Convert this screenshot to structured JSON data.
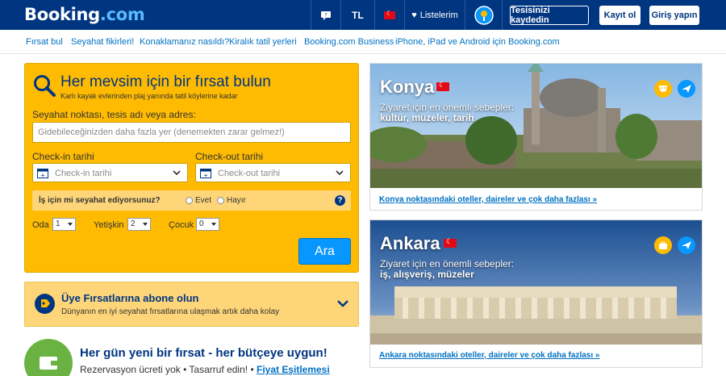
{
  "header": {
    "logo_main": "Booking",
    "logo_suffix": ".com",
    "currency": "TL",
    "wishlist_label": "Listelerim",
    "register_property": "Tesisinizi kaydedin",
    "register": "Kayıt ol",
    "sign_in": "Giriş yapın",
    "colors": {
      "brand_blue": "#003580",
      "light_blue": "#0896ff",
      "yellow": "#febb02",
      "turkey_red": "#e30a17"
    }
  },
  "subnav": {
    "items": [
      "Fırsat bul",
      "Seyahat fikirleri!",
      "Konaklamanız nasıldı?",
      "Kiralık tatil yerleri",
      "Booking.com Business",
      "iPhone, iPad ve Android için Booking.com"
    ]
  },
  "search": {
    "title": "Her mevsim için bir fırsat bulun",
    "subtitle": "Karlı kayak evlerinden plaj yanında tatil köylerine kadar",
    "destination_label": "Seyahat noktası, tesis adı veya adres:",
    "destination_placeholder": "Gidebileceğinizden daha fazla yer (denemekten zarar gelmez!)",
    "checkin_label": "Check-in tarihi",
    "checkin_placeholder": "Check-in tarihi",
    "checkout_label": "Check-out tarihi",
    "checkout_placeholder": "Check-out tarihi",
    "business_question": "İş için mi seyahat ediyorsunuz?",
    "yes_label": "Evet",
    "no_label": "Hayır",
    "help_symbol": "?",
    "rooms_label": "Oda",
    "rooms_value": "1",
    "adults_label": "Yetişkin",
    "adults_value": "2",
    "children_label": "Çocuk",
    "children_value": "0",
    "submit_label": "Ara"
  },
  "member_deals": {
    "title": "Üye Fırsatlarına abone olun",
    "subtitle": "Dünyanın en iyi seyahat fırsatlarına ulaşmak artık daha kolay"
  },
  "daily_deal": {
    "title": "Her gün yeni bir fırsat - her bütçeye uygun!",
    "text_1": "Rezervasyon ücreti yok",
    "separator": "•",
    "text_2": "Tasarruf edin!",
    "link": "Fiyat Eşitlemesi"
  },
  "cards": [
    {
      "city": "Konya",
      "why_label": "Ziyaret için en önemli sebepler:",
      "tags": "kültür, müzeler, tarih",
      "link": "Konya noktasındaki oteller, daireler ve çok daha fazlası »"
    },
    {
      "city": "Ankara",
      "why_label": "Ziyaret için en önemli sebepler:",
      "tags": "iş, alışveriş, müzeler",
      "link": "Ankara noktasındaki oteller, daireler ve çok daha fazlası »"
    }
  ]
}
